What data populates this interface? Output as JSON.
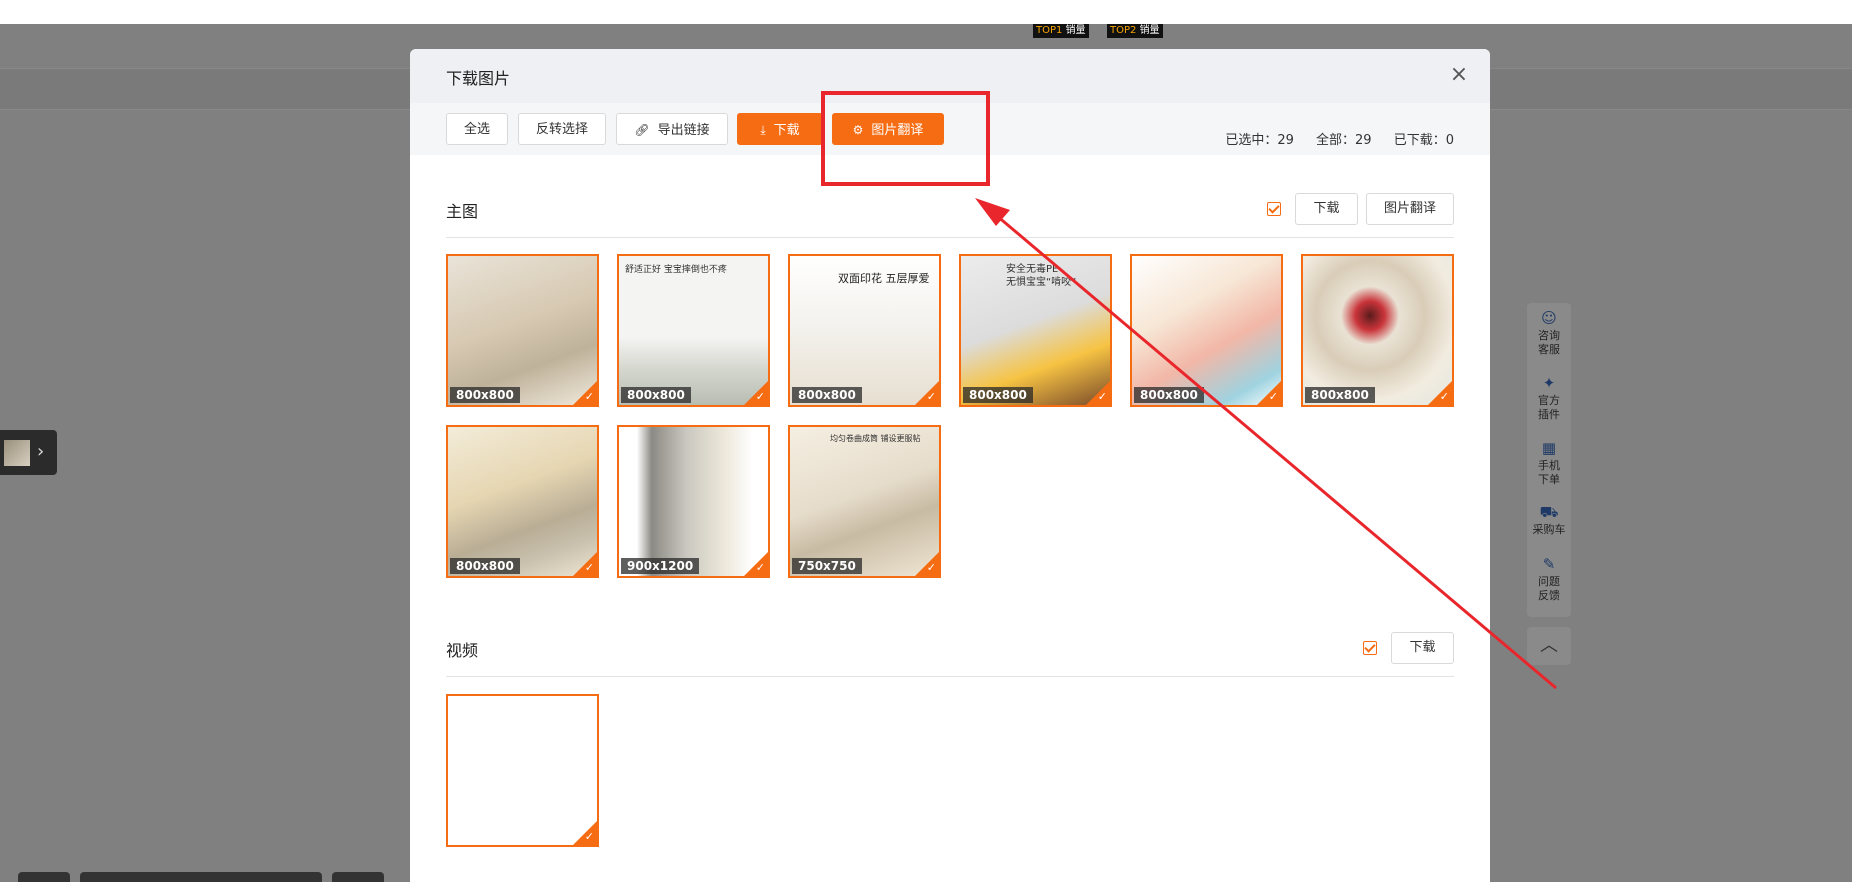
{
  "background": {
    "top_badges": [
      {
        "rank": "TOP1",
        "label": "销量"
      },
      {
        "rank": "TOP2",
        "label": "销量"
      }
    ]
  },
  "modal": {
    "title": "下载图片",
    "close_label": "×",
    "toolbar": {
      "select_all": "全选",
      "invert_select": "反转选择",
      "export_links": "导出链接",
      "download": "下载",
      "translate": "图片翻译"
    },
    "stats": {
      "selected": "已选中：29",
      "total": "全部：29",
      "downloaded": "已下载：0"
    },
    "main_section": {
      "title": "主图",
      "download_label": "下载",
      "translate_label": "图片翻译",
      "images": [
        {
          "size": "800x800",
          "caption": "",
          "caption2": ""
        },
        {
          "size": "800x800",
          "caption": "舒适正好 宝宝摔倒也不疼",
          "caption2": ""
        },
        {
          "size": "800x800",
          "caption": "",
          "caption2": "双面印花 五层厚爱"
        },
        {
          "size": "800x800",
          "caption": "安全无毒PE",
          "caption2": "无惧宝宝“啃咬”"
        },
        {
          "size": "800x800",
          "caption": "",
          "caption2": ""
        },
        {
          "size": "800x800",
          "caption": "",
          "caption2": ""
        },
        {
          "size": "800x800",
          "caption": "",
          "caption2": ""
        },
        {
          "size": "900x1200",
          "caption": "",
          "caption2": ""
        },
        {
          "size": "750x750",
          "caption": "均匀卷曲成筒 铺设更服帖",
          "caption2": ""
        }
      ]
    },
    "video_section": {
      "title": "视频",
      "download_label": "下载",
      "videos": [
        {
          "size": ""
        }
      ]
    }
  },
  "side_panel": {
    "items": [
      {
        "icon": "☺",
        "label1": "咨询",
        "label2": "客服"
      },
      {
        "icon": "✦",
        "label1": "官方",
        "label2": "插件"
      },
      {
        "icon": "▦",
        "label1": "手机",
        "label2": "下单"
      },
      {
        "icon": "⛟",
        "label1": "采购车",
        "label2": ""
      },
      {
        "icon": "✎",
        "label1": "问题",
        "label2": "反馈"
      }
    ],
    "up_icon": "︿"
  },
  "colors": {
    "accent": "#f66c12",
    "annotation_red": "#e8262b",
    "overlay": "#808080"
  }
}
